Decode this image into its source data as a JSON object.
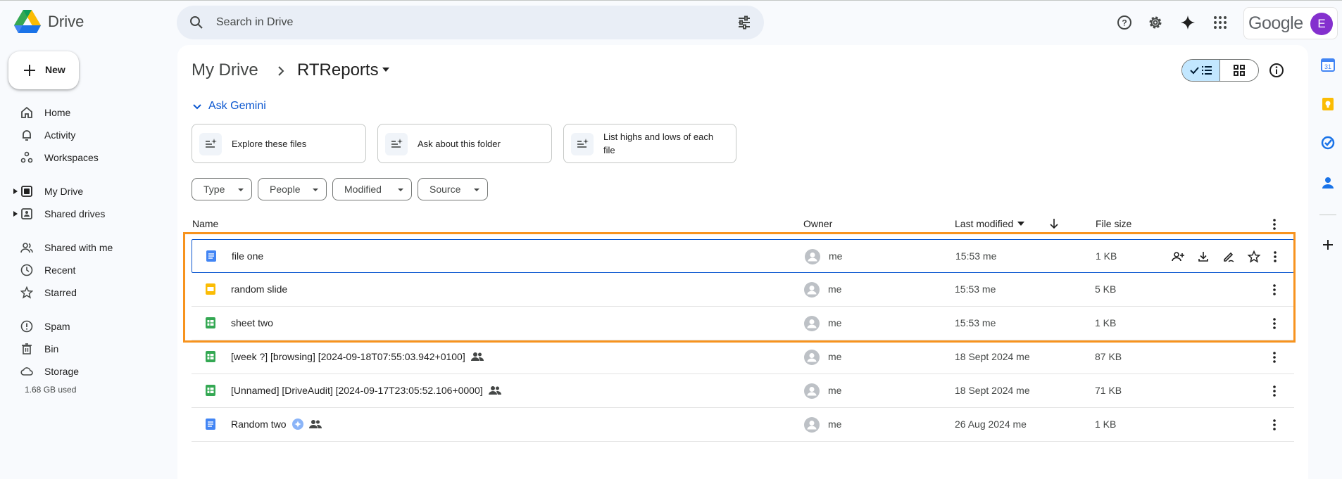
{
  "app": {
    "name": "Drive",
    "brand_text": "Google",
    "avatar_letter": "E"
  },
  "search": {
    "placeholder": "Search in Drive"
  },
  "sidebar": {
    "new_label": "New",
    "items": [
      {
        "label": "Home",
        "icon": "home-icon"
      },
      {
        "label": "Activity",
        "icon": "bell-icon"
      },
      {
        "label": "Workspaces",
        "icon": "workspaces-icon"
      },
      {
        "label": "My Drive",
        "icon": "my-drive-icon"
      },
      {
        "label": "Shared drives",
        "icon": "shared-drives-icon"
      },
      {
        "label": "Shared with me",
        "icon": "people-icon"
      },
      {
        "label": "Recent",
        "icon": "clock-icon"
      },
      {
        "label": "Starred",
        "icon": "star-icon"
      },
      {
        "label": "Spam",
        "icon": "spam-icon"
      },
      {
        "label": "Bin",
        "icon": "trash-icon"
      },
      {
        "label": "Storage",
        "icon": "cloud-icon"
      }
    ],
    "storage_used": "1.68 GB used"
  },
  "breadcrumb": {
    "root": "My Drive",
    "current": "RTReports"
  },
  "gemini": {
    "label": "Ask Gemini",
    "suggestions": [
      {
        "line1": "Explore these files",
        "line2": ""
      },
      {
        "line1": "Ask about this folder",
        "line2": ""
      },
      {
        "line1": "List highs and lows of each",
        "line2": "file"
      }
    ]
  },
  "filters": [
    "Type",
    "People",
    "Modified",
    "Source"
  ],
  "table": {
    "headers": {
      "name": "Name",
      "owner": "Owner",
      "modified": "Last modified",
      "size": "File size"
    },
    "rows": [
      {
        "name": "file one",
        "type": "doc",
        "owner": "me",
        "modified": "15:53 me",
        "size": "1 KB",
        "shared": false,
        "ai": false
      },
      {
        "name": "random slide",
        "type": "slide",
        "owner": "me",
        "modified": "15:53 me",
        "size": "5 KB",
        "shared": false,
        "ai": false
      },
      {
        "name": "sheet two",
        "type": "sheet",
        "owner": "me",
        "modified": "15:53 me",
        "size": "1 KB",
        "shared": false,
        "ai": false
      },
      {
        "name": "[week ?] [browsing] [2024-09-18T07:55:03.942+0100]",
        "type": "sheet",
        "owner": "me",
        "modified": "18 Sept 2024 me",
        "size": "87 KB",
        "shared": true,
        "ai": false
      },
      {
        "name": "[Unnamed] [DriveAudit] [2024-09-17T23:05:52.106+0000]",
        "type": "sheet",
        "owner": "me",
        "modified": "18 Sept 2024 me",
        "size": "71 KB",
        "shared": true,
        "ai": false
      },
      {
        "name": "Random two",
        "type": "doc",
        "owner": "me",
        "modified": "26 Aug 2024 me",
        "size": "1 KB",
        "shared": true,
        "ai": true
      }
    ]
  },
  "colors": {
    "accent": "#0b57d0",
    "highlight": "#f7931e",
    "doc": "#4285f4",
    "slide": "#fbbc04",
    "sheet": "#34a853"
  }
}
